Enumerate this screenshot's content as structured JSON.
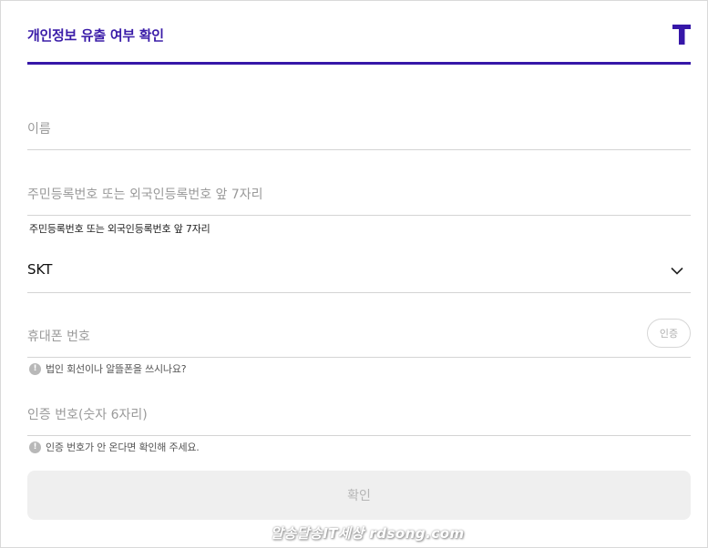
{
  "header": {
    "title": "개인정보 유출 여부 확인",
    "logo_icon": "t-logo-icon",
    "accent_color": "#3617a8"
  },
  "form": {
    "name": {
      "placeholder": "이름",
      "value": ""
    },
    "rrn": {
      "placeholder": "주민등록번호 또는 외국인등록번호 앞 7자리",
      "value": "",
      "hint": "주민등록번호 또는 외국인등록번호 앞 7자리"
    },
    "carrier": {
      "selected": "SKT",
      "icon": "chevron-down-icon"
    },
    "phone": {
      "placeholder": "휴대폰 번호",
      "value": "",
      "verify_label": "인증",
      "note": "법인 회선이나 알뜰폰을 쓰시나요?"
    },
    "code": {
      "placeholder": "인증 번호(숫자 6자리)",
      "value": "",
      "note": "인증 번호가 안 온다면 확인해 주세요."
    },
    "confirm_label": "확인"
  },
  "watermark": "알송달송IT세상 rdsong.com"
}
